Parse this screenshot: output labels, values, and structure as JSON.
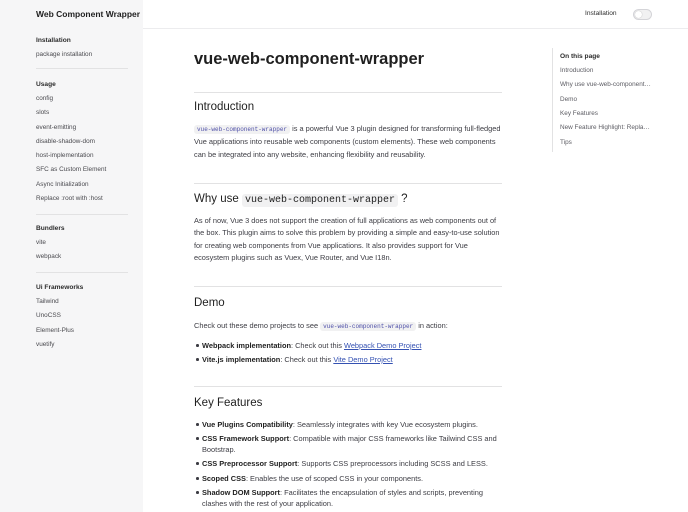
{
  "site": {
    "title": "Web Component Wrapper"
  },
  "nav": {
    "link": "Installation",
    "toggle_icon": "theme-toggle"
  },
  "sidebar": {
    "groups": [
      {
        "title": "Installation",
        "items": [
          "package installation"
        ]
      },
      {
        "title": "Usage",
        "items": [
          "config",
          "slots",
          "event-emitting",
          "disable-shadow-dom",
          "host-implementation",
          "SFC as Custom Element",
          "Async Initialization",
          "Replace :root with :host"
        ]
      },
      {
        "title": "Bundlers",
        "items": [
          "vite",
          "webpack"
        ]
      },
      {
        "title": "Ui Frameworks",
        "items": [
          "Tailwind",
          "UnoCSS",
          "Element-Plus",
          "vuetify"
        ]
      }
    ]
  },
  "page": {
    "title": "vue-web-component-wrapper",
    "intro": {
      "heading": "Introduction",
      "code": "vue-web-component-wrapper",
      "text": " is a powerful Vue 3 plugin designed for transforming full-fledged Vue applications into reusable web components (custom elements). These web components can be integrated into any website, enhancing flexibility and reusability."
    },
    "why": {
      "heading_prefix": "Why use ",
      "heading_code": "vue-web-component-wrapper",
      "heading_suffix": " ?",
      "text": "As of now, Vue 3 does not support the creation of full applications as web components out of the box. This plugin aims to solve this problem by providing a simple and easy-to-use solution for creating web components from Vue applications. It also provides support for Vue ecosystem plugins such as Vuex, Vue Router, and Vue I18n."
    },
    "demo": {
      "heading": "Demo",
      "intro_prefix": "Check out these demo projects to see ",
      "intro_code": "vue-web-component-wrapper",
      "intro_suffix": " in action:",
      "items": [
        {
          "bold": "Webpack implementation",
          "text": ": Check out this ",
          "link": "Webpack Demo Project"
        },
        {
          "bold": "Vite.js implementation",
          "text": ": Check out this ",
          "link": "Vite Demo Project"
        }
      ]
    },
    "features": {
      "heading": "Key Features",
      "items": [
        {
          "bold": "Vue Plugins Compatibility",
          "text": ": Seamlessly integrates with key Vue ecosystem plugins."
        },
        {
          "bold": "CSS Framework Support",
          "text": ": Compatible with major CSS frameworks like Tailwind CSS and Bootstrap."
        },
        {
          "bold": "CSS Preprocessor Support",
          "text": ": Supports CSS preprocessors including SCSS and LESS."
        },
        {
          "bold": "Scoped CSS",
          "text": ": Enables the use of scoped CSS in your components."
        },
        {
          "bold": "Shadow DOM Support",
          "text": ": Facilitates the encapsulation of styles and scripts, preventing clashes with the rest of your application."
        }
      ]
    }
  },
  "outline": {
    "title": "On this page",
    "items": [
      "Introduction",
      "Why use vue-web-component-wrapper?",
      "Demo",
      "Key Features",
      "New Feature Highlight: Replace :root with :host",
      "Tips"
    ]
  },
  "colors": {
    "link": "#3451b2",
    "code": "#4e4fa8",
    "sidebar_bg": "#f6f6f7"
  }
}
